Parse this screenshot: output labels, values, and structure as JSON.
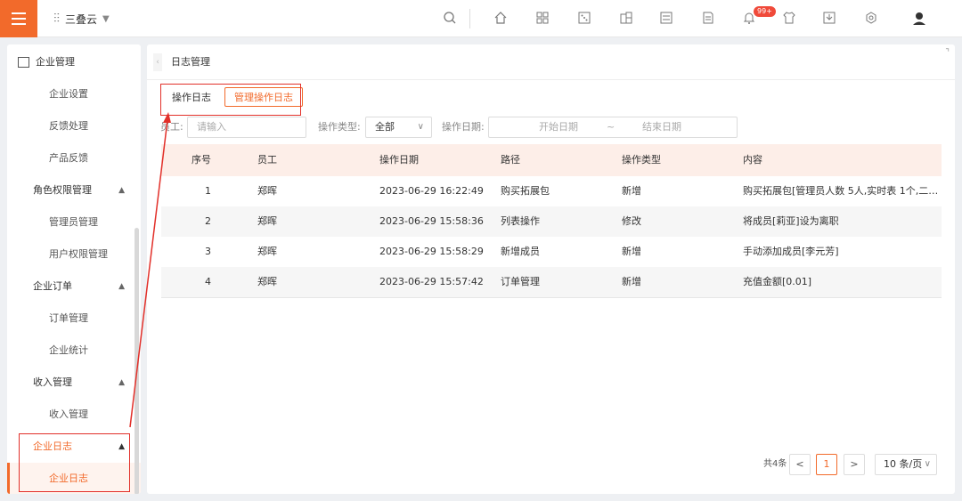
{
  "topbar": {
    "brand": "三叠云",
    "notification_badge": "99+",
    "icons": [
      "search-icon",
      "home-icon",
      "apps-icon",
      "dice-icon",
      "widgets-icon",
      "list-icon",
      "doc-icon",
      "bell-icon",
      "shirt-icon",
      "download-icon",
      "settings-icon",
      "user-avatar-icon"
    ]
  },
  "sidebar": {
    "root": "企业管理",
    "items": [
      {
        "label": "企业设置",
        "level": "sub"
      },
      {
        "label": "反馈处理",
        "level": "sub"
      },
      {
        "label": "产品反馈",
        "level": "sub"
      },
      {
        "label": "角色权限管理",
        "level": "group"
      },
      {
        "label": "管理员管理",
        "level": "sub"
      },
      {
        "label": "用户权限管理",
        "level": "sub"
      },
      {
        "label": "企业订单",
        "level": "group"
      },
      {
        "label": "订单管理",
        "level": "sub"
      },
      {
        "label": "企业统计",
        "level": "sub"
      },
      {
        "label": "收入管理",
        "level": "group"
      },
      {
        "label": "收入管理",
        "level": "sub"
      },
      {
        "label": "企业日志",
        "level": "group",
        "active": true
      },
      {
        "label": "企业日志",
        "level": "sub",
        "active": true
      }
    ]
  },
  "main": {
    "breadcrumb": "日志管理",
    "tabs": [
      {
        "label": "操作日志",
        "active": false
      },
      {
        "label": "管理操作日志",
        "active": true
      }
    ],
    "filters": {
      "employee_label": "员工:",
      "employee_placeholder": "请输入",
      "type_label": "操作类型:",
      "type_value": "全部",
      "date_label": "操作日期:",
      "start_placeholder": "开始日期",
      "range_sep": "~",
      "end_placeholder": "结束日期"
    },
    "table": {
      "headers": [
        "序号",
        "员工",
        "操作日期",
        "路径",
        "操作类型",
        "内容"
      ],
      "rows": [
        [
          "1",
          "郑晖",
          "2023-06-29 16:22:49",
          "购买拓展包",
          "新增",
          "购买拓展包[管理员人数 5人,实时表 1个,二级..."
        ],
        [
          "2",
          "郑晖",
          "2023-06-29 15:58:36",
          "列表操作",
          "修改",
          "将成员[莉亚]设为离职"
        ],
        [
          "3",
          "郑晖",
          "2023-06-29 15:58:29",
          "新增成员",
          "新增",
          "手动添加成员[李元芳]"
        ],
        [
          "4",
          "郑晖",
          "2023-06-29 15:57:42",
          "订单管理",
          "新增",
          "充值金额[0.01]"
        ]
      ]
    },
    "pager": {
      "total": "共4条",
      "prev": "<",
      "current": "1",
      "next": ">",
      "page_size": "10 条/页"
    }
  },
  "colors": {
    "accent": "#f26a2b",
    "annotation_red": "#e2302a",
    "header_bg": "#fdeee8"
  }
}
